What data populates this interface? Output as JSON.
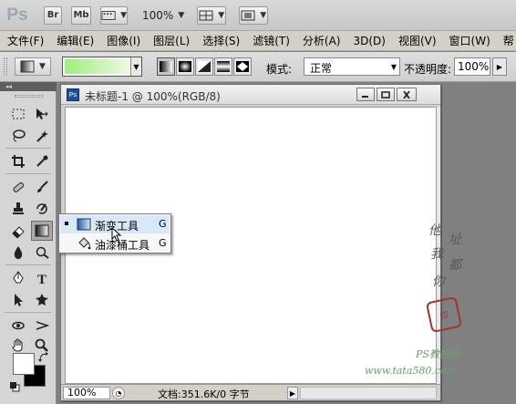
{
  "app": {
    "logo": "Ps"
  },
  "appbar": {
    "bridge_label": "Br",
    "minibridge_label": "Mb",
    "zoom_value": "100%"
  },
  "menubar": {
    "items": [
      {
        "label": "文件(F)"
      },
      {
        "label": "编辑(E)"
      },
      {
        "label": "图像(I)"
      },
      {
        "label": "图层(L)"
      },
      {
        "label": "选择(S)"
      },
      {
        "label": "滤镜(T)"
      },
      {
        "label": "分析(A)"
      },
      {
        "label": "3D(D)"
      },
      {
        "label": "视图(V)"
      },
      {
        "label": "窗口(W)"
      },
      {
        "label": "帮"
      }
    ]
  },
  "options": {
    "mode_label": "模式:",
    "mode_value": "正常",
    "opacity_label": "不透明度:",
    "opacity_value": "100%",
    "gradient_colors": [
      "#9ef07a",
      "#eef8e2"
    ]
  },
  "tools_header": "◂◂",
  "document": {
    "title": "未标题-1 @ 100%(RGB/8)",
    "icon_label": "Ps",
    "zoom": "100%",
    "info": "文档:351.6K/0 字节"
  },
  "flyout": {
    "items": [
      {
        "label": "渐变工具",
        "key": "G",
        "selected": true
      },
      {
        "label": "油漆桶工具",
        "key": "G",
        "selected": false
      }
    ]
  },
  "watermark": {
    "chars": [
      "他",
      "址",
      "我",
      "都",
      "你"
    ],
    "seal": "印",
    "site": "PS教程网",
    "url": "www.tata580.com"
  },
  "colors": {
    "foreground": "#ffffff",
    "background": "#000000",
    "accent": "#1d4f9a"
  }
}
